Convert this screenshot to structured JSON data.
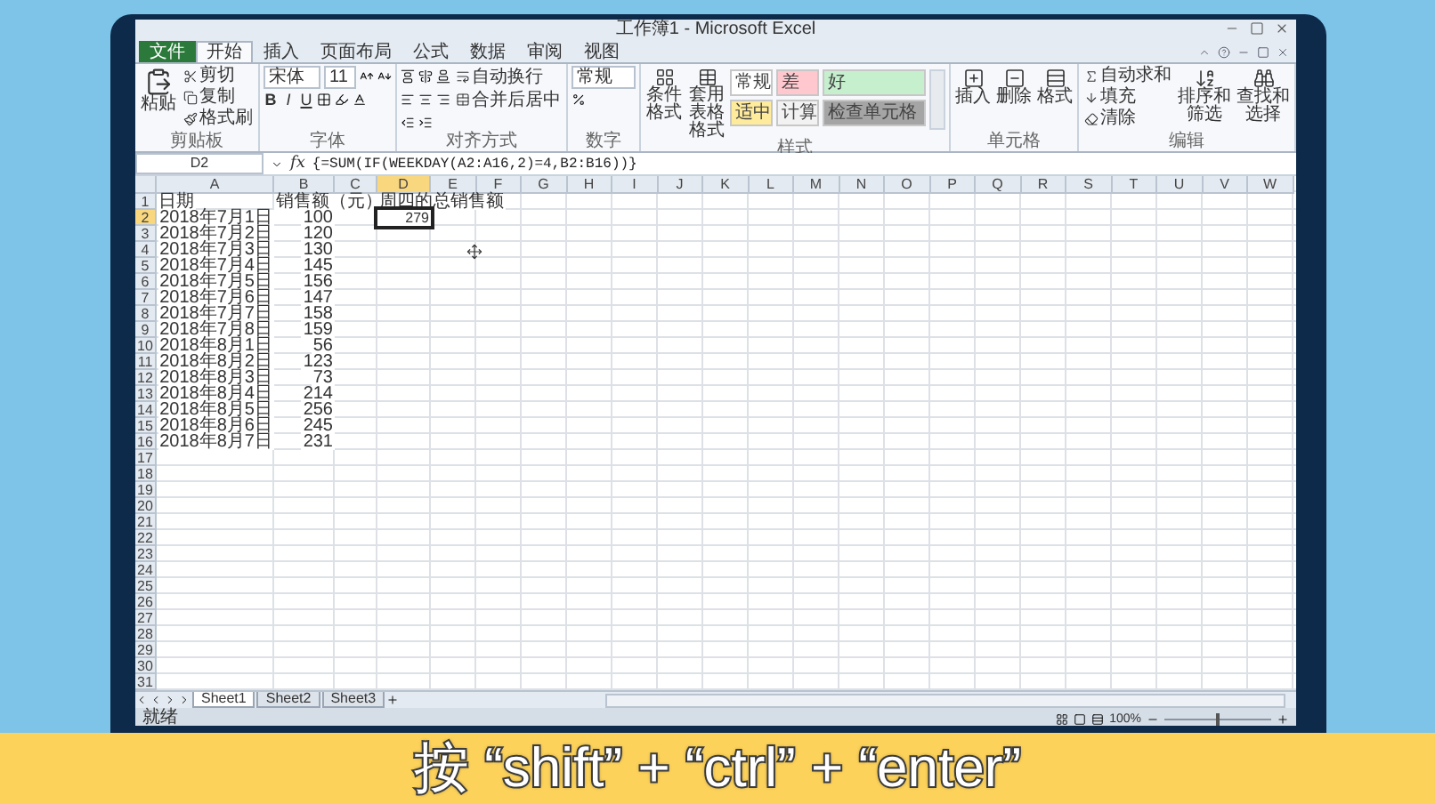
{
  "window": {
    "title": "工作簿1 - Microsoft Excel"
  },
  "tabs": [
    {
      "label": "文件",
      "kind": "file",
      "selected": false
    },
    {
      "label": "开始",
      "kind": "tab",
      "selected": true
    },
    {
      "label": "插入",
      "kind": "tab",
      "selected": false
    },
    {
      "label": "页面布局",
      "kind": "tab",
      "selected": false
    },
    {
      "label": "公式",
      "kind": "tab",
      "selected": false
    },
    {
      "label": "数据",
      "kind": "tab",
      "selected": false
    },
    {
      "label": "审阅",
      "kind": "tab",
      "selected": false
    },
    {
      "label": "视图",
      "kind": "tab",
      "selected": false
    }
  ],
  "clipboard": {
    "paste": "粘贴",
    "items": [
      "剪切",
      "复制",
      "格式刷"
    ],
    "label": "剪贴板"
  },
  "font": {
    "name": "宋体",
    "size": "11",
    "styles": [
      "B",
      "I",
      "U"
    ],
    "label": "字体"
  },
  "alignment": {
    "wrap": "自动换行",
    "merge": "合并后居中",
    "label": "对齐方式"
  },
  "number": {
    "format": "常规",
    "label": "数字"
  },
  "styles": {
    "conditional": "条件格式",
    "table": "套用表格格式",
    "label": "样式",
    "cells": [
      {
        "label": "常规",
        "color": "#ffffff"
      },
      {
        "label": "差",
        "color": "#ffc7ce"
      },
      {
        "label": "好",
        "color": "#c6efce"
      },
      {
        "label": "适中",
        "color": "#ffeb9c"
      },
      {
        "label": "计算",
        "color": "#f2f2f2"
      },
      {
        "label": "检查单元格",
        "color": "#a5a5a5"
      }
    ]
  },
  "cells_group": {
    "buttons": [
      "插入",
      "删除",
      "格式"
    ],
    "label": "单元格"
  },
  "editing": {
    "items": [
      "自动求和",
      "填充",
      "清除"
    ],
    "sort": "排序和筛选",
    "find": "查找和选择",
    "label": "编辑"
  },
  "formula_bar": {
    "name_box": "D2",
    "fx": "fx",
    "formula": "{=SUM(IF(WEEKDAY(A2:A16,2)=4,B2:B16))}"
  },
  "columns": [
    {
      "label": "A",
      "selected": false
    },
    {
      "label": "B",
      "selected": false
    },
    {
      "label": "C",
      "selected": false
    },
    {
      "label": "D",
      "selected": true
    },
    {
      "label": "E",
      "selected": false
    },
    {
      "label": "F",
      "selected": false
    },
    {
      "label": "G",
      "selected": false
    },
    {
      "label": "H",
      "selected": false
    },
    {
      "label": "I",
      "selected": false
    },
    {
      "label": "J",
      "selected": false
    },
    {
      "label": "K",
      "selected": false
    },
    {
      "label": "L",
      "selected": false
    },
    {
      "label": "M",
      "selected": false
    },
    {
      "label": "N",
      "selected": false
    },
    {
      "label": "O",
      "selected": false
    },
    {
      "label": "P",
      "selected": false
    },
    {
      "label": "Q",
      "selected": false
    },
    {
      "label": "R",
      "selected": false
    },
    {
      "label": "S",
      "selected": false
    },
    {
      "label": "T",
      "selected": false
    },
    {
      "label": "U",
      "selected": false
    },
    {
      "label": "V",
      "selected": false
    },
    {
      "label": "W",
      "selected": false
    }
  ],
  "row_numbers": [
    {
      "label": "1",
      "selected": false
    },
    {
      "label": "2",
      "selected": true
    },
    {
      "label": "3",
      "selected": false
    },
    {
      "label": "4",
      "selected": false
    },
    {
      "label": "5",
      "selected": false
    },
    {
      "label": "6",
      "selected": false
    },
    {
      "label": "7",
      "selected": false
    },
    {
      "label": "8",
      "selected": false
    },
    {
      "label": "9",
      "selected": false
    },
    {
      "label": "10",
      "selected": false
    },
    {
      "label": "11",
      "selected": false
    },
    {
      "label": "12",
      "selected": false
    },
    {
      "label": "13",
      "selected": false
    },
    {
      "label": "14",
      "selected": false
    },
    {
      "label": "15",
      "selected": false
    },
    {
      "label": "16",
      "selected": false
    },
    {
      "label": "17",
      "selected": false
    },
    {
      "label": "18",
      "selected": false
    },
    {
      "label": "19",
      "selected": false
    },
    {
      "label": "20",
      "selected": false
    },
    {
      "label": "21",
      "selected": false
    },
    {
      "label": "22",
      "selected": false
    },
    {
      "label": "23",
      "selected": false
    },
    {
      "label": "24",
      "selected": false
    },
    {
      "label": "25",
      "selected": false
    },
    {
      "label": "26",
      "selected": false
    },
    {
      "label": "27",
      "selected": false
    },
    {
      "label": "28",
      "selected": false
    },
    {
      "label": "29",
      "selected": false
    },
    {
      "label": "30",
      "selected": false
    },
    {
      "label": "31",
      "selected": false
    }
  ],
  "headers": {
    "a": "日期",
    "b": "销售额（元）"
  },
  "records": [
    {
      "date": "2018年7月1日",
      "sales": "100"
    },
    {
      "date": "2018年7月2日",
      "sales": "120"
    },
    {
      "date": "2018年7月3日",
      "sales": "130"
    },
    {
      "date": "2018年7月4日",
      "sales": "145"
    },
    {
      "date": "2018年7月5日",
      "sales": "156"
    },
    {
      "date": "2018年7月6日",
      "sales": "147"
    },
    {
      "date": "2018年7月7日",
      "sales": "158"
    },
    {
      "date": "2018年7月8日",
      "sales": "159"
    },
    {
      "date": "2018年8月1日",
      "sales": "56"
    },
    {
      "date": "2018年8月2日",
      "sales": "123"
    },
    {
      "date": "2018年8月3日",
      "sales": "73"
    },
    {
      "date": "2018年8月4日",
      "sales": "214"
    },
    {
      "date": "2018年8月5日",
      "sales": "256"
    },
    {
      "date": "2018年8月6日",
      "sales": "245"
    },
    {
      "date": "2018年8月7日",
      "sales": "231"
    }
  ],
  "summary": {
    "header": "周四的总销售额",
    "value": "279",
    "selected": true
  },
  "sheets": [
    {
      "label": "Sheet1",
      "selected": true
    },
    {
      "label": "Sheet2",
      "selected": false
    },
    {
      "label": "Sheet3",
      "selected": false
    }
  ],
  "status_bar": {
    "text": "就绪",
    "zoom": "100%",
    "level": 0.5
  },
  "caption": {
    "text": "按 “shift” + “ctrl” + “enter”"
  }
}
